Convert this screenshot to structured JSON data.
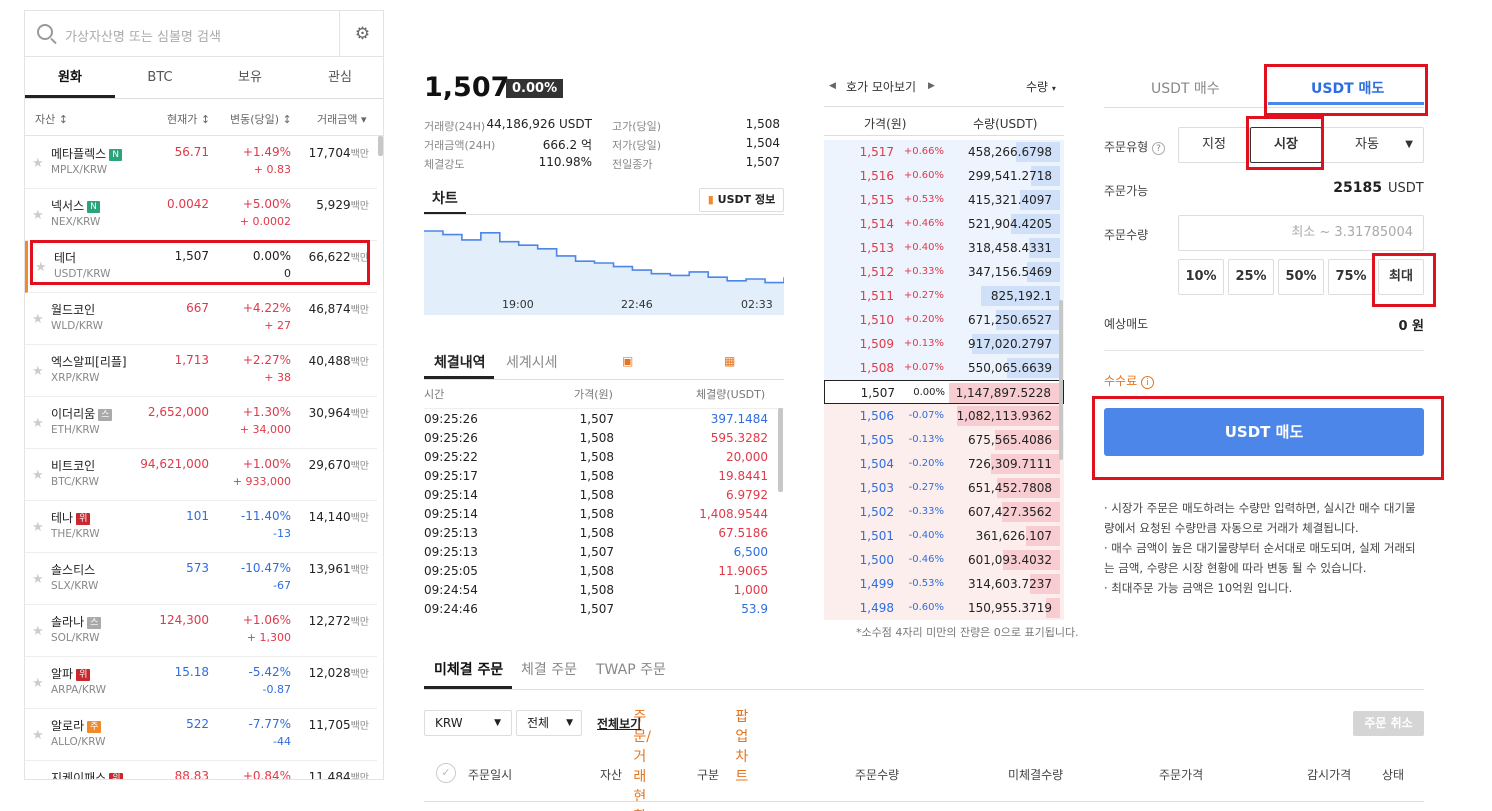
{
  "search": {
    "placeholder": "가상자산명 또는 심볼명 검색"
  },
  "tabs": [
    "원화",
    "BTC",
    "보유",
    "관심"
  ],
  "columns": {
    "asset": "자산 ↕",
    "price": "현재가 ↕",
    "change": "변동(당일) ↕",
    "volume": "거래금액 ▾"
  },
  "coins": [
    {
      "name": "메타플렉스",
      "badge": "N",
      "badgeColor": "#2ba37c",
      "symbol": "MPLX/KRW",
      "price": "56.71",
      "pct": "+1.49%",
      "diff": "+ 0.83",
      "vol": "17,704",
      "unit": "백만",
      "dir": "up"
    },
    {
      "name": "넥서스",
      "badge": "N",
      "badgeColor": "#2ba37c",
      "symbol": "NEX/KRW",
      "price": "0.0042",
      "pct": "+5.00%",
      "diff": "+ 0.0002",
      "vol": "5,929",
      "unit": "백만",
      "dir": "up"
    },
    {
      "name": "테더",
      "badge": "",
      "badgeColor": "",
      "symbol": "USDT/KRW",
      "price": "1,507",
      "pct": "0.00%",
      "diff": "0",
      "vol": "66,622",
      "unit": "백만",
      "dir": "flat"
    },
    {
      "name": "월드코인",
      "badge": "",
      "badgeColor": "",
      "symbol": "WLD/KRW",
      "price": "667",
      "pct": "+4.22%",
      "diff": "+ 27",
      "vol": "46,874",
      "unit": "백만",
      "dir": "up"
    },
    {
      "name": "엑스알피[리플]",
      "badge": "",
      "badgeColor": "",
      "symbol": "XRP/KRW",
      "price": "1,713",
      "pct": "+2.27%",
      "diff": "+ 38",
      "vol": "40,488",
      "unit": "백만",
      "dir": "up"
    },
    {
      "name": "이더리움",
      "badge": "스",
      "badgeColor": "#aaa",
      "symbol": "ETH/KRW",
      "price": "2,652,000",
      "pct": "+1.30%",
      "diff": "+ 34,000",
      "vol": "30,964",
      "unit": "백만",
      "dir": "up"
    },
    {
      "name": "비트코인",
      "badge": "",
      "badgeColor": "",
      "symbol": "BTC/KRW",
      "price": "94,621,000",
      "pct": "+1.00%",
      "diff": "+ 933,000",
      "vol": "29,670",
      "unit": "백만",
      "dir": "up"
    },
    {
      "name": "테나",
      "badge": "위",
      "badgeColor": "#c8282e",
      "symbol": "THE/KRW",
      "price": "101",
      "pct": "-11.40%",
      "diff": "-13",
      "vol": "14,140",
      "unit": "백만",
      "dir": "down"
    },
    {
      "name": "솔스티스",
      "badge": "",
      "badgeColor": "",
      "symbol": "SLX/KRW",
      "price": "573",
      "pct": "-10.47%",
      "diff": "-67",
      "vol": "13,961",
      "unit": "백만",
      "dir": "down"
    },
    {
      "name": "솔라나",
      "badge": "스",
      "badgeColor": "#aaa",
      "symbol": "SOL/KRW",
      "price": "124,300",
      "pct": "+1.06%",
      "diff": "+ 1,300",
      "vol": "12,272",
      "unit": "백만",
      "dir": "up"
    },
    {
      "name": "알파",
      "badge": "위",
      "badgeColor": "#c8282e",
      "symbol": "ARPA/KRW",
      "price": "15.18",
      "pct": "-5.42%",
      "diff": "-0.87",
      "vol": "12,028",
      "unit": "백만",
      "dir": "down"
    },
    {
      "name": "알로라",
      "badge": "주",
      "badgeColor": "#f08a2a",
      "symbol": "ALLO/KRW",
      "price": "522",
      "pct": "-7.77%",
      "diff": "-44",
      "vol": "11,705",
      "unit": "백만",
      "dir": "down"
    },
    {
      "name": "지케이패스",
      "badge": "위",
      "badgeColor": "#c8282e",
      "symbol": "",
      "price": "88.83",
      "pct": "+0.84%",
      "diff": "",
      "vol": "11,484",
      "unit": "백만",
      "dir": "up"
    }
  ],
  "ticker": {
    "price": "1,507",
    "pct": "0.00%",
    "vol24_label": "거래량(24H)",
    "vol24": "44,186,926 USDT",
    "amt24_label": "거래금액(24H)",
    "amt24": "666.2 억",
    "strength_label": "체결강도",
    "strength": "110.98%",
    "high_label": "고가(당일)",
    "high": "1,508",
    "low_label": "저가(당일)",
    "low": "1,504",
    "prev_label": "전일종가",
    "prev": "1,507"
  },
  "chart": {
    "tab": "차트",
    "info_button": "USDT 정보",
    "times": [
      "19:00",
      "22:46",
      "02:33"
    ]
  },
  "chart_data": {
    "type": "line",
    "x": [
      "19:00",
      "22:46",
      "02:33"
    ],
    "values": [
      1509.6,
      1509.4,
      1509.1,
      1509.5,
      1509.0,
      1508.8,
      1508.6,
      1508.2,
      1507.9,
      1507.8,
      1507.6,
      1507.4,
      1507.2,
      1507.1,
      1507.3,
      1507.0,
      1506.8,
      1506.9,
      1506.7,
      1507.0
    ],
    "ylim": [
      1506,
      1510.5
    ]
  },
  "trades": {
    "tab1": "체결내역",
    "tab2": "세계시세",
    "link1": "주문/거래현황",
    "link2": "팝업차트",
    "h_time": "시간",
    "h_price": "가격(원)",
    "h_qty": "체결량(USDT)",
    "rows": [
      {
        "t": "09:25:26",
        "p": "1,507",
        "q": "397.1484",
        "dir": "down"
      },
      {
        "t": "09:25:26",
        "p": "1,508",
        "q": "595.3282",
        "dir": "up"
      },
      {
        "t": "09:25:22",
        "p": "1,508",
        "q": "20,000",
        "dir": "up"
      },
      {
        "t": "09:25:17",
        "p": "1,508",
        "q": "19.8441",
        "dir": "up"
      },
      {
        "t": "09:25:14",
        "p": "1,508",
        "q": "6.9792",
        "dir": "up"
      },
      {
        "t": "09:25:14",
        "p": "1,508",
        "q": "1,408.9544",
        "dir": "up"
      },
      {
        "t": "09:25:13",
        "p": "1,508",
        "q": "67.5186",
        "dir": "up"
      },
      {
        "t": "09:25:13",
        "p": "1,507",
        "q": "6,500",
        "dir": "down"
      },
      {
        "t": "09:25:05",
        "p": "1,508",
        "q": "11.9065",
        "dir": "up"
      },
      {
        "t": "09:24:54",
        "p": "1,508",
        "q": "1,000",
        "dir": "up"
      },
      {
        "t": "09:24:46",
        "p": "1,507",
        "q": "53.9",
        "dir": "down"
      }
    ]
  },
  "orderbook": {
    "title": "호가 모아보기",
    "qty_toggle": "수량",
    "h_price": "가격(원)",
    "h_qty": "수량(USDT)",
    "asks": [
      {
        "p": "1,517",
        "c": "+0.66%",
        "q": "458,266.6798",
        "w": 0.4
      },
      {
        "p": "1,516",
        "c": "+0.60%",
        "q": "299,541.2718",
        "w": 0.26
      },
      {
        "p": "1,515",
        "c": "+0.53%",
        "q": "415,321.4097",
        "w": 0.36
      },
      {
        "p": "1,514",
        "c": "+0.46%",
        "q": "521,904.4205",
        "w": 0.45
      },
      {
        "p": "1,513",
        "c": "+0.40%",
        "q": "318,458.4331",
        "w": 0.28
      },
      {
        "p": "1,512",
        "c": "+0.33%",
        "q": "347,156.5469",
        "w": 0.3
      },
      {
        "p": "1,511",
        "c": "+0.27%",
        "q": "825,192.1",
        "w": 0.72
      },
      {
        "p": "1,510",
        "c": "+0.20%",
        "q": "671,250.6527",
        "w": 0.58
      },
      {
        "p": "1,509",
        "c": "+0.13%",
        "q": "917,020.2797",
        "w": 0.8
      },
      {
        "p": "1,508",
        "c": "+0.07%",
        "q": "550,065.6639",
        "w": 0.48
      }
    ],
    "current": {
      "p": "1,507",
      "c": "0.00%",
      "q": "1,147,897.5228",
      "w": 1.0
    },
    "bids": [
      {
        "p": "1,506",
        "c": "-0.07%",
        "q": "1,082,113.9362",
        "w": 0.94
      },
      {
        "p": "1,505",
        "c": "-0.13%",
        "q": "675,565.4086",
        "w": 0.59
      },
      {
        "p": "1,504",
        "c": "-0.20%",
        "q": "726,309.7111",
        "w": 0.63
      },
      {
        "p": "1,503",
        "c": "-0.27%",
        "q": "651,452.7808",
        "w": 0.57
      },
      {
        "p": "1,502",
        "c": "-0.33%",
        "q": "607,427.3562",
        "w": 0.53
      },
      {
        "p": "1,501",
        "c": "-0.40%",
        "q": "361,626.107",
        "w": 0.31
      },
      {
        "p": "1,500",
        "c": "-0.46%",
        "q": "601,093.4032",
        "w": 0.52
      },
      {
        "p": "1,499",
        "c": "-0.53%",
        "q": "314,603.7237",
        "w": 0.27
      },
      {
        "p": "1,498",
        "c": "-0.60%",
        "q": "150,955.3719",
        "w": 0.13
      }
    ],
    "note": "*소수점 4자리 미만의 잔량은 0으로 표기됩니다."
  },
  "order": {
    "buy_tab": "USDT 매수",
    "sell_tab": "USDT 매도",
    "type_label": "주문유형",
    "types": [
      "지정",
      "시장",
      "자동"
    ],
    "avail_label": "주문가능",
    "avail": "25185",
    "avail_unit": "USDT",
    "qty_label": "주문수량",
    "qty_placeholder": "최소 ~ 3.31785004",
    "pcts": [
      "10%",
      "25%",
      "50%",
      "75%",
      "최대"
    ],
    "est_label": "예상매도",
    "est": "0 원",
    "fee_label": "수수료",
    "sell_button": "USDT 매도",
    "notes": [
      "· 시장가 주문은 매도하려는 수량만 입력하면, 실시간 매수 대기물량에서 요청된 수량만큼 자동으로 거래가 체결됩니다.",
      "· 매수 금액이 높은 대기물량부터 순서대로 매도되며, 실제 거래되는 금액, 수량은 시장 현황에 따라 변동 될 수 있습니다.",
      "· 최대주문 가능 금액은 10억원 입니다."
    ]
  },
  "bottom": {
    "tabs": [
      "미체결 주문",
      "체결 주문",
      "TWAP 주문"
    ],
    "currency": "KRW",
    "filter": "전체",
    "view_all": "전체보기",
    "cancel": "주문 취소",
    "cols": [
      "주문일시",
      "자산",
      "구분",
      "주문수량",
      "미체결수량",
      "주문가격",
      "감시가격",
      "상태"
    ]
  },
  "colors": {
    "up": "#e0394a",
    "down": "#2d6de0",
    "accent": "#4d86e9",
    "highlight": "#e0101e"
  }
}
